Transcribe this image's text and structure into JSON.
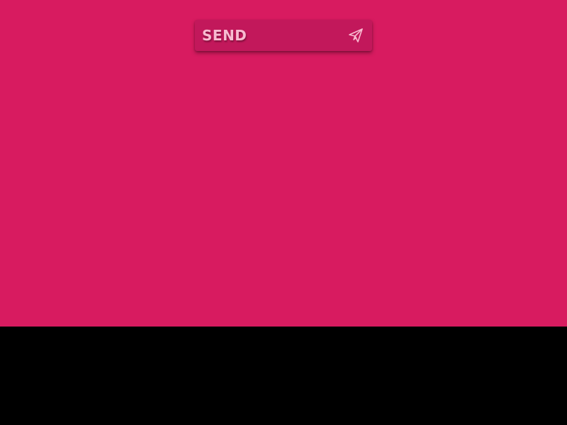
{
  "colors": {
    "background": "#d81b60",
    "button_background": "#c2185b",
    "button_text": "#f8bbd0",
    "bottom_area": "#000000"
  },
  "send_button": {
    "label": "SEND",
    "icon": "paper-plane-icon"
  }
}
